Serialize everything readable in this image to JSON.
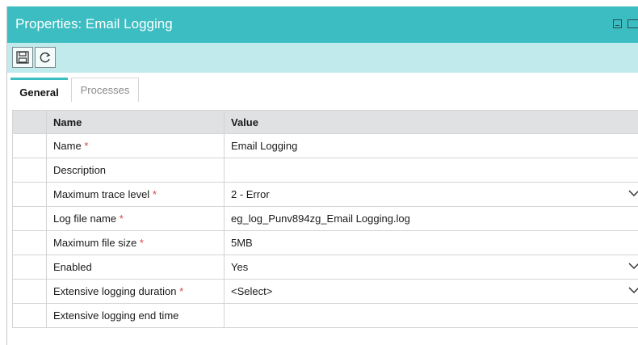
{
  "window": {
    "title": "Properties: Email Logging"
  },
  "toolbar": {
    "buttons": [
      {
        "icon": "save-icon"
      },
      {
        "icon": "refresh-icon"
      }
    ]
  },
  "tabs": [
    {
      "label": "General",
      "active": true
    },
    {
      "label": "Processes",
      "active": false
    }
  ],
  "grid": {
    "columns": [
      "Name",
      "Value"
    ],
    "required_marker": "*",
    "rows": [
      {
        "name": "Name",
        "required": true,
        "value": "Email Logging",
        "dropdown": false
      },
      {
        "name": "Description",
        "required": false,
        "value": "",
        "dropdown": false
      },
      {
        "name": "Maximum trace level",
        "required": true,
        "value": "2 - Error",
        "dropdown": true
      },
      {
        "name": "Log file name",
        "required": true,
        "value": "eg_log_Punv894zg_Email Logging.log",
        "dropdown": false
      },
      {
        "name": "Maximum file size",
        "required": true,
        "value": "5MB",
        "dropdown": false
      },
      {
        "name": "Enabled",
        "required": false,
        "value": "Yes",
        "dropdown": true
      },
      {
        "name": "Extensive logging duration",
        "required": true,
        "value": "<Select>",
        "dropdown": true
      },
      {
        "name": "Extensive logging end time",
        "required": false,
        "value": "",
        "dropdown": false
      }
    ]
  },
  "colors": {
    "titlebar": "#3bbdc2",
    "toolbar": "#c1eaec",
    "required": "#d64545",
    "header_row": "#dfe1e3"
  }
}
